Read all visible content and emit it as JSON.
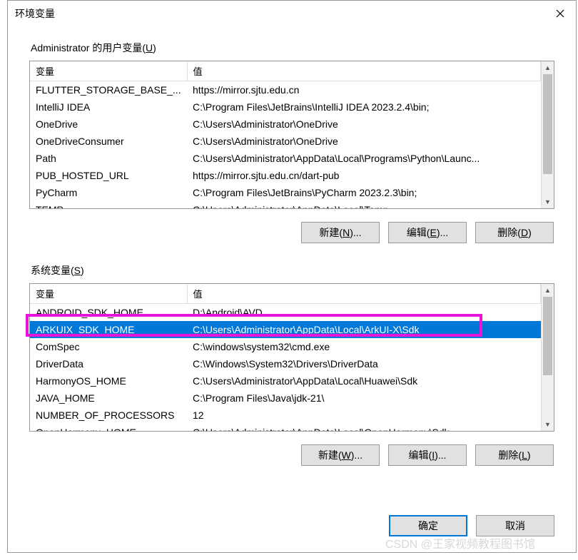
{
  "window": {
    "title": "环境变量"
  },
  "user_vars": {
    "label_prefix": "Administrator 的用户变量(",
    "label_key": "U",
    "label_suffix": ")",
    "columns": {
      "name": "变量",
      "value": "值"
    },
    "rows": [
      {
        "name": "FLUTTER_STORAGE_BASE_...",
        "value": "https://mirror.sjtu.edu.cn"
      },
      {
        "name": "IntelliJ IDEA",
        "value": "C:\\Program Files\\JetBrains\\IntelliJ IDEA 2023.2.4\\bin;"
      },
      {
        "name": "OneDrive",
        "value": "C:\\Users\\Administrator\\OneDrive"
      },
      {
        "name": "OneDriveConsumer",
        "value": "C:\\Users\\Administrator\\OneDrive"
      },
      {
        "name": "Path",
        "value": "C:\\Users\\Administrator\\AppData\\Local\\Programs\\Python\\Launc..."
      },
      {
        "name": "PUB_HOSTED_URL",
        "value": "https://mirror.sjtu.edu.cn/dart-pub"
      },
      {
        "name": "PyCharm",
        "value": "C:\\Program Files\\JetBrains\\PyCharm 2023.2.3\\bin;"
      },
      {
        "name": "TEMP",
        "value": "C:\\Users\\Administrator\\AppData\\Local\\Temp"
      }
    ],
    "buttons": {
      "new_text": "新建(",
      "new_key": "N",
      "new_suffix": ")...",
      "edit_text": "编辑(",
      "edit_key": "E",
      "edit_suffix": ")...",
      "del_text": "删除(",
      "del_key": "D",
      "del_suffix": ")"
    }
  },
  "system_vars": {
    "label_prefix": "系统变量(",
    "label_key": "S",
    "label_suffix": ")",
    "columns": {
      "name": "变量",
      "value": "值"
    },
    "selected_index": 1,
    "rows": [
      {
        "name": "ANDROID_SDK_HOME",
        "value": "D:\\Android\\AVD"
      },
      {
        "name": "ARKUIX_SDK_HOME",
        "value": "C:\\Users\\Administrator\\AppData\\Local\\ArkUI-X\\Sdk"
      },
      {
        "name": "ComSpec",
        "value": "C:\\windows\\system32\\cmd.exe"
      },
      {
        "name": "DriverData",
        "value": "C:\\Windows\\System32\\Drivers\\DriverData"
      },
      {
        "name": "HarmonyOS_HOME",
        "value": "C:\\Users\\Administrator\\AppData\\Local\\Huawei\\Sdk"
      },
      {
        "name": "JAVA_HOME",
        "value": "C:\\Program Files\\Java\\jdk-21\\"
      },
      {
        "name": "NUMBER_OF_PROCESSORS",
        "value": "12"
      },
      {
        "name": "OpenHarmony_HOME",
        "value": "C:\\Users\\Administrator\\AppData\\Local\\OpenHarmony\\Sdk"
      }
    ],
    "buttons": {
      "new_text": "新建(",
      "new_key": "W",
      "new_suffix": ")...",
      "edit_text": "编辑(",
      "edit_key": "I",
      "edit_suffix": ")...",
      "del_text": "删除(",
      "del_key": "L",
      "del_suffix": ")"
    }
  },
  "footer": {
    "ok": "确定",
    "cancel": "取消"
  },
  "watermark": "CSDN @王家视频教程图书馆"
}
